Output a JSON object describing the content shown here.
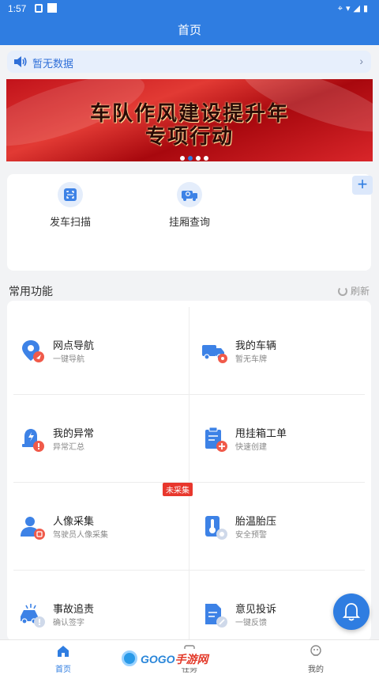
{
  "status_bar": {
    "time": "1:57"
  },
  "header": {
    "title": "首页"
  },
  "notice": {
    "text": "暂无数据",
    "chevron": "›"
  },
  "banner": {
    "line1": "车队作风建设提升年",
    "line2": "专项行动",
    "slide_count": 4,
    "active_slide": 2
  },
  "quick_actions": {
    "add_label": "+",
    "items": [
      {
        "label": "发车扫描",
        "icon": "scan-icon"
      },
      {
        "label": "挂厢查询",
        "icon": "truck-search-icon"
      }
    ]
  },
  "common": {
    "title": "常用功能",
    "refresh_label": "刷新",
    "items": [
      {
        "title": "网点导航",
        "sub": "一键导航",
        "icon": "location-nav-icon"
      },
      {
        "title": "我的车辆",
        "sub": "暂无车牌",
        "icon": "truck-icon"
      },
      {
        "title": "我的异常",
        "sub": "异常汇总",
        "icon": "alarm-icon"
      },
      {
        "title": "甩挂箱工单",
        "sub": "快速创建",
        "icon": "clipboard-add-icon"
      },
      {
        "title": "人像采集",
        "sub": "驾驶员人像采集",
        "icon": "person-scan-icon"
      },
      {
        "title": "胎温胎压",
        "sub": "安全预警",
        "icon": "thermometer-icon"
      },
      {
        "title": "事故追责",
        "sub": "确认签字",
        "icon": "car-accident-icon"
      },
      {
        "title": "意见投诉",
        "sub": "一键反馈",
        "icon": "feedback-doc-icon"
      }
    ],
    "uncollected_tag": "未采集"
  },
  "bottom_nav": [
    {
      "label": "首页",
      "icon": "home-icon",
      "active": true
    },
    {
      "label": "任务",
      "icon": "task-icon",
      "active": false
    },
    {
      "label": "我的",
      "icon": "profile-icon",
      "active": false
    }
  ],
  "watermark": {
    "latin": "GOGO",
    "cn": "手游网"
  },
  "colors": {
    "primary": "#2f7de1",
    "notice_bg": "#e7effc",
    "tag_red": "#e8372d",
    "icon_badge": "#f05a4a"
  }
}
